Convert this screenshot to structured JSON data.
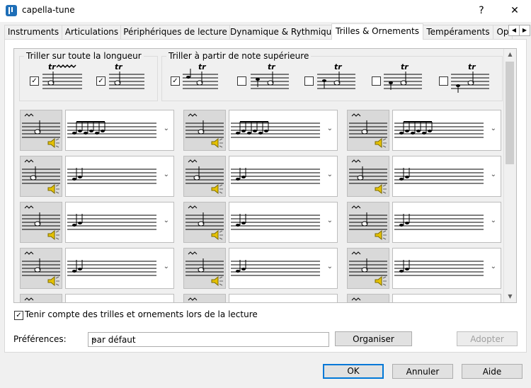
{
  "window": {
    "title": "capella-tune",
    "help_symbol": "?",
    "close_symbol": "✕"
  },
  "tabs": [
    {
      "label": "Instruments"
    },
    {
      "label": "Articulations"
    },
    {
      "label": "Périphériques de lecture"
    },
    {
      "label": "Dynamique & Rythmique"
    },
    {
      "label": "Trilles & Ornements",
      "active": true
    },
    {
      "label": "Tempéraments"
    },
    {
      "label": "Op"
    }
  ],
  "tab_scroll": {
    "left": "◀",
    "right": "▶"
  },
  "groups": {
    "whole": {
      "label": "Triller sur toute la longueur"
    },
    "upper": {
      "label": "Triller à partir de note supérieure"
    }
  },
  "playback_checkbox": {
    "label": "Tenir compte des trilles et ornements lors de la lecture",
    "checked": true
  },
  "preferences": {
    "label": "Préférences:",
    "value": "par défaut"
  },
  "buttons": {
    "organize": "Organiser",
    "adopt": "Adopter",
    "ok": "OK",
    "cancel": "Annuler",
    "help": "Aide"
  },
  "scroll_arrows": {
    "up": "▲",
    "down": "▼"
  },
  "dropdown_arrow": "⌄",
  "colors": {
    "accent": "#0078d7",
    "speaker": "#e6c200"
  }
}
